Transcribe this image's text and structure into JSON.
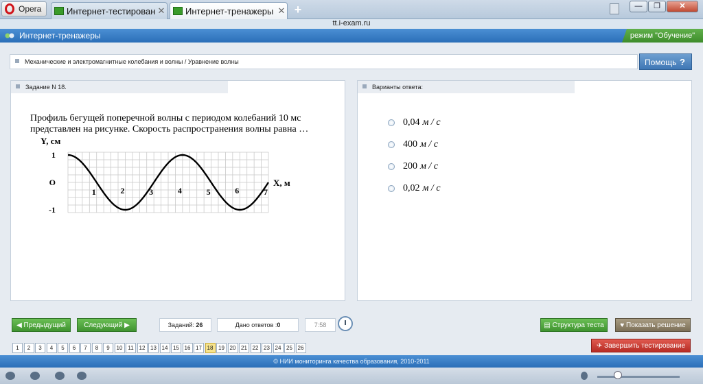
{
  "browser": {
    "menu_label": "Opera",
    "tabs": [
      {
        "title": "Интернет-тестирование",
        "active": false
      },
      {
        "title": "Интернет-тренажеры",
        "active": true
      }
    ],
    "new_tab_label": "+",
    "address": "tt.i-exam.ru"
  },
  "app": {
    "title": "Интернет-тренажеры",
    "mode_label": "режим \"Обучение\""
  },
  "breadcrumb": "Механические и электромагнитные колебания и волны / Уравнение волны",
  "help_label": "Помощь",
  "task": {
    "header": "Задание N 18.",
    "text": "Профиль бегущей поперечной волны с периодом колебаний 10 мс представлен на рисунке. Скорость распространения волны равна …"
  },
  "chart_data": {
    "type": "line",
    "ylabel": "Y, см",
    "xlabel": "X, м",
    "y_ticks": [
      "1",
      "O",
      "-1"
    ],
    "x_ticks": [
      "1",
      "2",
      "3",
      "4",
      "5",
      "6",
      "7"
    ],
    "xlim": [
      0,
      7
    ],
    "ylim": [
      -1,
      1
    ],
    "grid": true,
    "series": [
      {
        "x": [
          0,
          0.5,
          1,
          1.5,
          2,
          2.5,
          3,
          3.5,
          4,
          4.5,
          5,
          5.5,
          6,
          6.5,
          7
        ],
        "y": [
          1,
          0.71,
          0,
          -0.71,
          -1,
          -0.71,
          0,
          0.71,
          1,
          0.71,
          0,
          -0.71,
          -1,
          -0.71,
          0
        ]
      }
    ]
  },
  "answers_panel": {
    "header": "Варианты ответа:",
    "options": [
      {
        "value": "0,04",
        "unit": "м / с"
      },
      {
        "value": "400",
        "unit": "м / с"
      },
      {
        "value": "200",
        "unit": "м / с"
      },
      {
        "value": "0,02",
        "unit": "м / с"
      }
    ]
  },
  "controls": {
    "prev_label": "Предыдущий",
    "next_label": "Следующий",
    "tasks_label": "Заданий:",
    "tasks_count": "26",
    "answered_label": "Дано ответов :",
    "answered_count": "0",
    "timer": "7:58",
    "structure_label": "Структура теста",
    "solution_label": "Показать решение",
    "finish_label": "Завершить тестирование"
  },
  "pagination": {
    "pages": [
      "1",
      "2",
      "3",
      "4",
      "5",
      "6",
      "7",
      "8",
      "9",
      "10",
      "11",
      "12",
      "13",
      "14",
      "15",
      "16",
      "17",
      "18",
      "19",
      "20",
      "21",
      "22",
      "23",
      "24",
      "25",
      "26"
    ],
    "current": "18"
  },
  "footer": "© НИИ мониторинга качества образования, 2010-2011"
}
